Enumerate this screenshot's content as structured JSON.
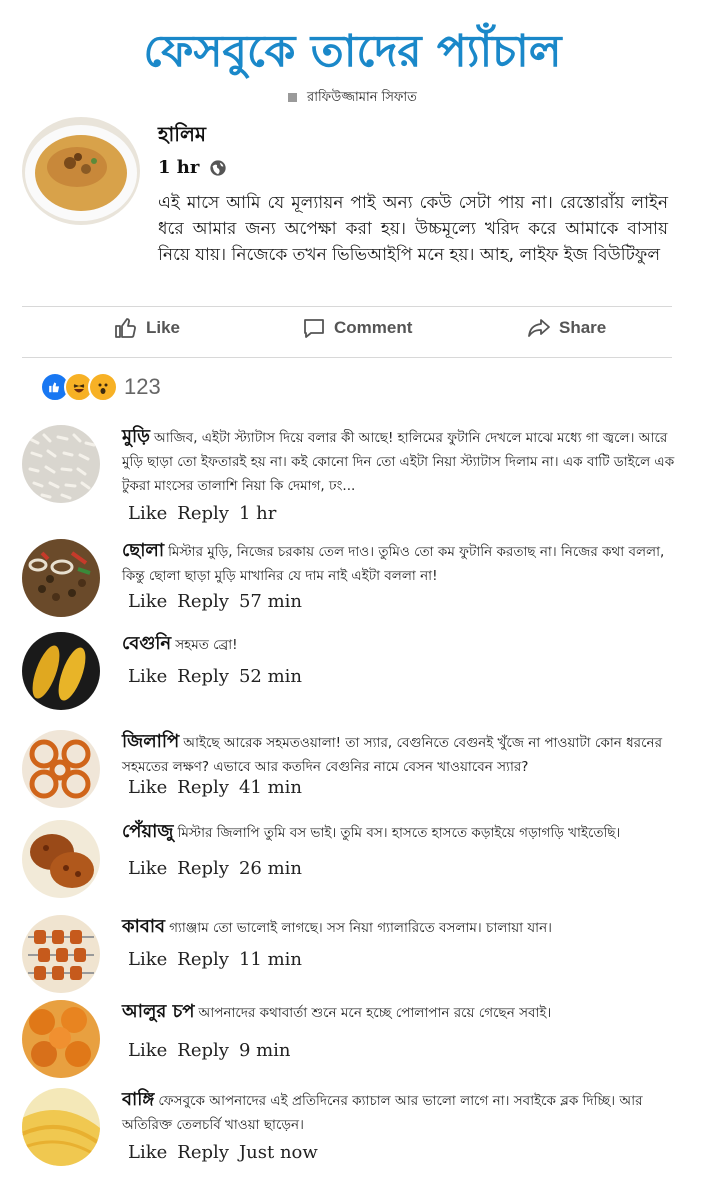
{
  "header": {
    "title": "ফেসবুকে তাদের প্যাঁচাল",
    "byline": "রাফিউজ্জামান সিফাত"
  },
  "post": {
    "name": "হালিম",
    "time": "1 hr",
    "text": "এই মাসে আমি যে মূল্যায়ন পাই অন্য কেউ সেটা পায় না। রেস্তোরাঁয় লাইন ধরে আমার জন্য অপেক্ষা করা হয়। উচ্চমূল্যে খরিদ করে আমাকে বাসায় নিয়ে যায়। নিজেকে তখন ভিভিআইপি মনে হয়। আহ, লাইফ ইজ বিউটিফুল"
  },
  "actions": {
    "like": "Like",
    "comment": "Comment",
    "share": "Share"
  },
  "reactions": {
    "count": "123"
  },
  "comments": [
    {
      "name": "মুড়ি",
      "text": "আজিব, এইটা স্ট্যাটাস দিয়ে বলার কী আছে! হালিমের ফুটানি দেখলে মাঝে মধ্যে গা জ্বলে। আরে মুড়ি ছাড়া তো ইফতারই হয় না। কই কোনো দিন তো এইটা নিয়া স্ট্যাটাস দিলাম না। এক বাটি ডাইলে এক টুকরা মাংসের তালাশি নিয়া কি দেমাগ, ঢং...",
      "like": "Like",
      "reply": "Reply",
      "time": "1 hr"
    },
    {
      "name": "ছোলা",
      "text": "মিস্টার মুড়ি, নিজের চরকায় তেল দাও। তুমিও তো কম ফুটানি করতাছ না। নিজের কথা বললা, কিন্তু ছোলা ছাড়া মুড়ি মাখানির যে দাম নাই এইটা বললা না!",
      "like": "Like",
      "reply": "Reply",
      "time": "57 min"
    },
    {
      "name": "বেগুনি",
      "text": "সহমত ব্রো!",
      "like": "Like",
      "reply": "Reply",
      "time": "52 min"
    },
    {
      "name": "জিলাপি",
      "text": "আইছে আরেক সহমতওয়ালা! তা স্যার, বেগুনিতে বেগুনই খুঁজে না পাওয়াটা কোন ধরনের সহমতের লক্ষণ? এভাবে আর কতদিন বেগুনির নামে বেসন খাওয়াবেন স্যার?",
      "like": "Like",
      "reply": "Reply",
      "time": "41 min"
    },
    {
      "name": "পেঁয়াজু",
      "text": "মিস্টার জিলাপি তুমি বস ভাই। তুমি বস। হাসতে হাসতে কড়াইয়ে গড়াগড়ি খাইতেছি।",
      "like": "Like",
      "reply": "Reply",
      "time": "26 min"
    },
    {
      "name": "কাবাব",
      "text": "গ্যাঞ্জাম তো ভালোই লাগছে। সস নিয়া গ্যালারিতে বসলাম। চালায়া যান।",
      "like": "Like",
      "reply": "Reply",
      "time": "11 min"
    },
    {
      "name": "আলুর চপ",
      "text": "আপনাদের কথাবার্তা শুনে মনে হচ্ছে পোলাপান রয়ে গেছেন সবাই।",
      "like": "Like",
      "reply": "Reply",
      "time": "9 min"
    },
    {
      "name": "বাঙ্গি",
      "text": "ফেসবুকে আপনাদের এই প্রতিদিনের ক্যাচাল আর ভালো লাগে না। সবাইকে ব্লক দিচ্ছি। আর অতিরিক্ত তেলচর্বি খাওয়া ছাড়েন।",
      "like": "Like",
      "reply": "Reply",
      "time": "Just now"
    }
  ],
  "colors": {
    "title": "#1a88c9",
    "like_blue": "#1877f2",
    "react_yellow": "#f7b125"
  }
}
